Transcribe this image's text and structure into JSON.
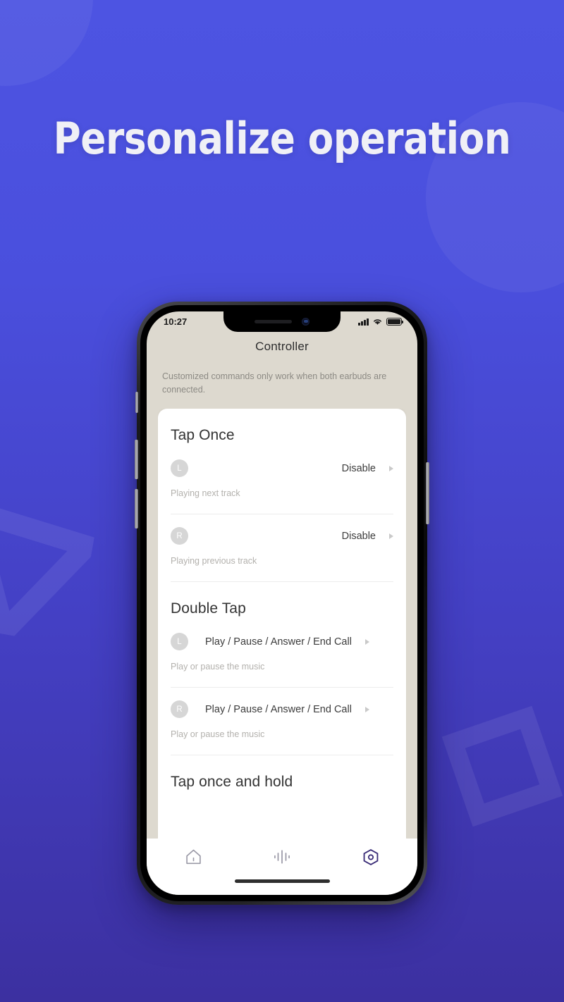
{
  "promo": {
    "headline": "Personalize operation",
    "background_top": "#4d54e2",
    "background_bottom": "#3c30a0",
    "decorations": [
      {
        "name": "circle-top-left",
        "shape": "circle"
      },
      {
        "name": "circle-top-right",
        "shape": "circle"
      },
      {
        "name": "triangle-left",
        "shape": "triangle-outline"
      },
      {
        "name": "diamond-right",
        "shape": "square-outline-rotated"
      }
    ]
  },
  "phone": {
    "statusbar": {
      "time": "10:27",
      "signal_icon": "cellular-bars-icon",
      "wifi_icon": "wifi-icon",
      "battery_icon": "battery-full-icon"
    },
    "nav": {
      "title": "Controller"
    },
    "note": "Customized commands only work when both earbuds are connected.",
    "sections": [
      {
        "title": "Tap Once",
        "rows": [
          {
            "side": "L",
            "value": "Disable",
            "desc": "Playing next track",
            "chevron": "chevron-right-icon"
          },
          {
            "side": "R",
            "value": "Disable",
            "desc": "Playing previous track",
            "chevron": "chevron-right-icon"
          }
        ]
      },
      {
        "title": "Double Tap",
        "rows": [
          {
            "side": "L",
            "value": "Play / Pause / Answer /  End Call",
            "desc": "Play or pause the music",
            "chevron": "chevron-right-icon"
          },
          {
            "side": "R",
            "value": "Play / Pause / Answer /  End Call",
            "desc": "Play or pause the music",
            "chevron": "chevron-right-icon"
          }
        ]
      },
      {
        "title": "Tap once and hold",
        "rows": []
      }
    ],
    "tabbar": {
      "tabs": [
        {
          "name": "home-icon",
          "label": "Home",
          "active": false,
          "color": "#9a99a6"
        },
        {
          "name": "equalizer-icon",
          "label": "Sound",
          "active": false,
          "color": "#9a99a6"
        },
        {
          "name": "settings-hexagon-icon",
          "label": "Settings",
          "active": true,
          "color": "#3b2d78"
        }
      ]
    }
  }
}
